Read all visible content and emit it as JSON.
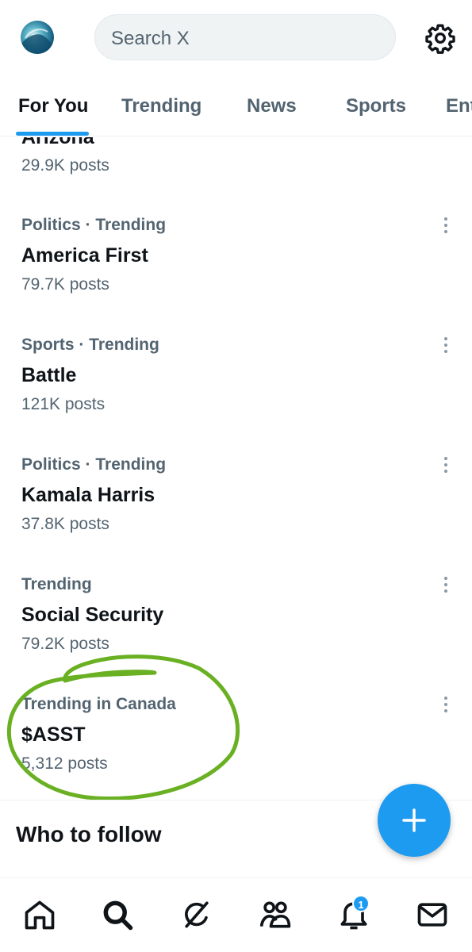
{
  "header": {
    "search_placeholder": "Search X"
  },
  "tabs": [
    {
      "label": "For You",
      "active": true
    },
    {
      "label": "Trending",
      "active": false
    },
    {
      "label": "News",
      "active": false
    },
    {
      "label": "Sports",
      "active": false
    },
    {
      "label": "Ent",
      "active": false
    }
  ],
  "partial_trend": {
    "title": "Arizona",
    "count": "29.9K posts"
  },
  "trends": [
    {
      "meta": "Politics · Trending",
      "title": "America First",
      "count": "79.7K posts"
    },
    {
      "meta": "Sports · Trending",
      "title": "Battle",
      "count": "121K posts"
    },
    {
      "meta": "Politics · Trending",
      "title": "Kamala Harris",
      "count": "37.8K posts"
    },
    {
      "meta": "Trending",
      "title": "Social Security",
      "count": "79.2K posts"
    },
    {
      "meta": "Trending in Canada",
      "title": "$ASST",
      "count": "5,312 posts"
    }
  ],
  "who_to_follow": {
    "heading": "Who to follow"
  },
  "bottom_nav": {
    "items": [
      "home-icon",
      "search-icon",
      "grok-icon",
      "communities-icon",
      "notifications-icon",
      "messages-icon"
    ],
    "notification_badge": "1"
  },
  "colors": {
    "accent": "#1d9bf0",
    "annotation": "#6ab023",
    "secondary_text": "#536471"
  }
}
